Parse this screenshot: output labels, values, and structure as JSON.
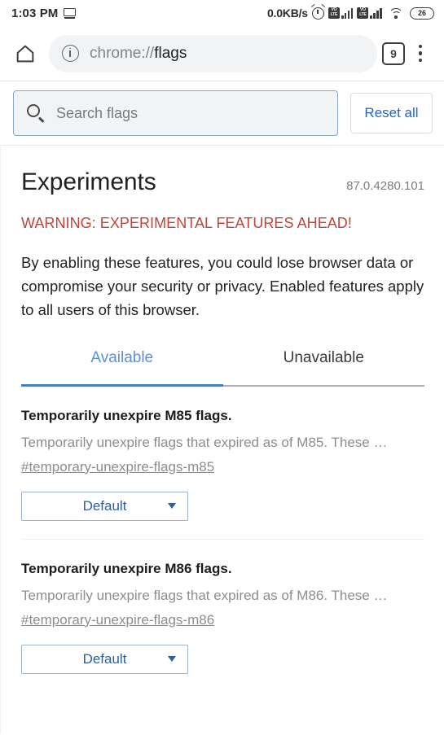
{
  "statusbar": {
    "time": "1:03 PM",
    "cast_icon": "cast-screen-icon",
    "network_speed": "0.0KB/s",
    "alarm_icon": "alarm-clock-icon",
    "sim1_label": "VoLTE",
    "sim2_label": "VoLTE",
    "wifi_icon": "wifi-icon",
    "battery_level": "26"
  },
  "toolbar": {
    "home_icon": "home-icon",
    "info_icon": "page-info-icon",
    "url_scheme": "chrome://",
    "url_path": "flags",
    "tab_count": "9",
    "menu_icon": "overflow-menu-icon"
  },
  "search": {
    "icon": "search-icon",
    "placeholder": "Search flags",
    "value": "",
    "reset_label": "Reset all"
  },
  "page": {
    "title": "Experiments",
    "version": "87.0.4280.101",
    "warning": "WARNING: EXPERIMENTAL FEATURES AHEAD!",
    "blurb": "By enabling these features, you could lose browser data or compromise your security or privacy. Enabled features apply to all users of this browser."
  },
  "tabs": [
    {
      "label": "Available",
      "active": true
    },
    {
      "label": "Unavailable",
      "active": false
    }
  ],
  "flags": [
    {
      "name": "Temporarily unexpire M85 flags.",
      "description": "Temporarily unexpire flags that expired as of M85. These …",
      "id": "#temporary-unexpire-flags-m85",
      "selected": "Default"
    },
    {
      "name": "Temporarily unexpire M86 flags.",
      "description": "Temporarily unexpire flags that expired as of M86. These …",
      "id": "#temporary-unexpire-flags-m86",
      "selected": "Default"
    }
  ],
  "colors": {
    "accent_blue": "#1967d2",
    "tab_active_blue": "#5b8fd6",
    "warning_red": "#c1443b",
    "select_blue": "#2c5f9e"
  }
}
